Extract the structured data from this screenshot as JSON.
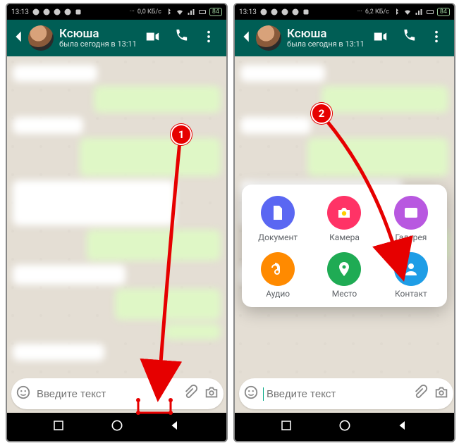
{
  "status": {
    "time": "13:13",
    "net_left": "0,0 КБ/с",
    "net_right": "6,2 КБ/с",
    "battery": "84"
  },
  "header": {
    "name": "Ксюша",
    "status": "была сегодня в 13:11"
  },
  "input": {
    "placeholder": "Введите текст"
  },
  "attach": {
    "document": "Документ",
    "camera": "Камера",
    "gallery": "Галерея",
    "audio": "Аудио",
    "location": "Место",
    "contact": "Контакт"
  },
  "colors": {
    "document": "#5a67f2",
    "camera": "#ff3366",
    "gallery": "#b858e0",
    "audio": "#ff8a00",
    "location": "#1fab54",
    "contact": "#1e9de6"
  },
  "anno": {
    "step1": "1",
    "step2": "2"
  }
}
